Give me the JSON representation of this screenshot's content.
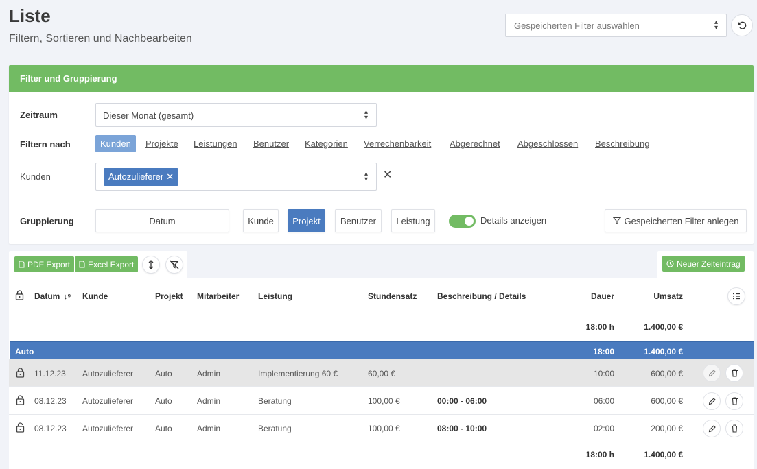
{
  "page": {
    "title": "Liste",
    "subtitle": "Filtern, Sortieren und Nachbearbeiten",
    "saved_filter_placeholder": "Gespeicherten Filter auswählen"
  },
  "filter_card": {
    "header": "Filter und Gruppierung",
    "zeitraum_label": "Zeitraum",
    "zeitraum_value": "Dieser Monat (gesamt)",
    "filtern_nach_label": "Filtern nach",
    "filter_links": [
      "Kunden",
      "Projekte",
      "Leistungen",
      "Benutzer",
      "Kategorien",
      "Verrechenbarkeit",
      "Abgerechnet",
      "Abgeschlossen",
      "Beschreibung"
    ],
    "active_filter": "Kunden",
    "kunden_label": "Kunden",
    "kunden_tag": "Autozulieferer",
    "gruppierung_label": "Gruppierung",
    "gruppierung_buttons": [
      "Datum",
      "Kunde",
      "Projekt",
      "Benutzer",
      "Leistung"
    ],
    "active_grouping": "Projekt",
    "details_label": "Details anzeigen",
    "details_enabled": true,
    "save_filter_label": "Gespeicherten Filter anlegen"
  },
  "toolbar": {
    "pdf_export": "PDF Export",
    "excel_export": "Excel Export",
    "new_entry": "Neuer Zeiteintrag"
  },
  "table": {
    "headers": {
      "datum": "Datum",
      "kunde": "Kunde",
      "projekt": "Projekt",
      "mitarbeiter": "Mitarbeiter",
      "leistung": "Leistung",
      "stundensatz": "Stundensatz",
      "beschreibung": "Beschreibung / Details",
      "dauer": "Dauer",
      "umsatz": "Umsatz"
    },
    "total_top": {
      "dauer": "18:00 h",
      "umsatz": "1.400,00 €"
    },
    "group": {
      "name": "Auto",
      "dauer": "18:00",
      "umsatz": "1.400,00 €"
    },
    "rows": [
      {
        "datum": "11.12.23",
        "kunde": "Autozulieferer",
        "projekt": "Auto",
        "mitarbeiter": "Admin",
        "leistung": "Implementierung 60 €",
        "stundensatz": "60,00 €",
        "details": "",
        "dauer": "10:00",
        "umsatz": "600,00 €",
        "locked": true
      },
      {
        "datum": "08.12.23",
        "kunde": "Autozulieferer",
        "projekt": "Auto",
        "mitarbeiter": "Admin",
        "leistung": "Beratung",
        "stundensatz": "100,00 €",
        "details": "00:00 - 06:00",
        "dauer": "06:00",
        "umsatz": "600,00 €",
        "locked": false
      },
      {
        "datum": "08.12.23",
        "kunde": "Autozulieferer",
        "projekt": "Auto",
        "mitarbeiter": "Admin",
        "leistung": "Beratung",
        "stundensatz": "100,00 €",
        "details": "08:00 - 10:00",
        "dauer": "02:00",
        "umsatz": "200,00 €",
        "locked": false
      }
    ],
    "total_bottom": {
      "dauer": "18:00 h",
      "umsatz": "1.400,00 €"
    }
  },
  "colors": {
    "green": "#72bb63",
    "blue": "#4a7bbf",
    "light_blue": "#7ba4d8"
  }
}
